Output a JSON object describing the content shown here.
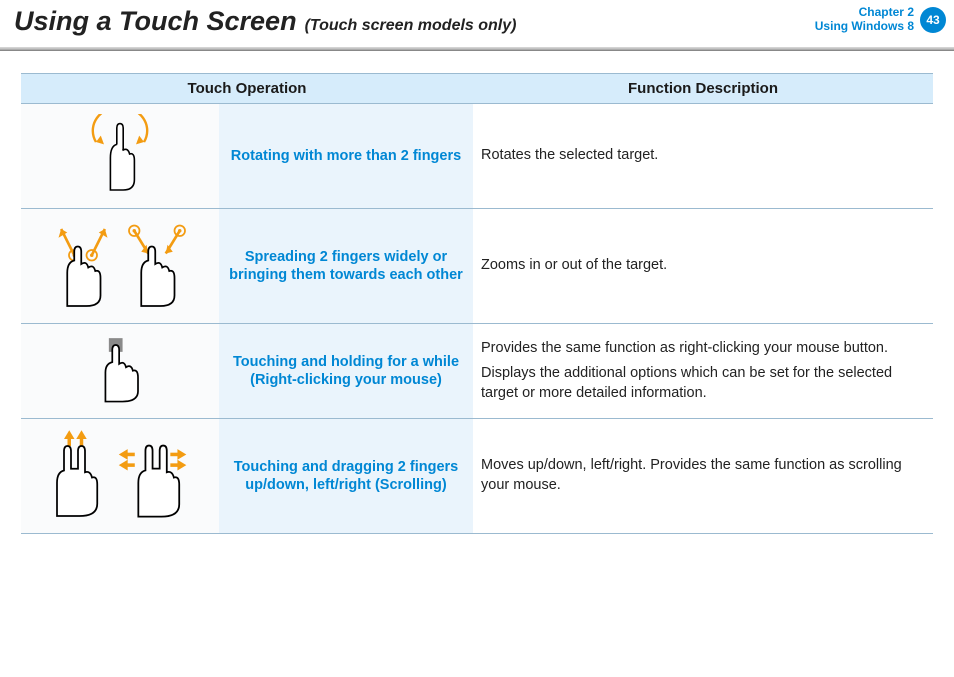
{
  "header": {
    "title_main": "Using a Touch Screen",
    "title_sub": "(Touch screen models only)",
    "chapter_line1": "Chapter 2",
    "chapter_line2": "Using Windows 8",
    "page_number": "43"
  },
  "table": {
    "head_operation": "Touch Operation",
    "head_description": "Function Description",
    "rows": [
      {
        "name": "Rotating with more than 2 fingers",
        "desc": [
          "Rotates the selected target."
        ]
      },
      {
        "name": "Spreading 2 fingers widely or bringing them towards each other",
        "desc": [
          "Zooms in or out of the target."
        ]
      },
      {
        "name": "Touching and holding for a while (Right-clicking your mouse)",
        "desc": [
          "Provides the same function as right-clicking your mouse button.",
          "Displays the additional options which can be set for the selected target or more detailed information."
        ]
      },
      {
        "name": "Touching and dragging 2 fingers up/down, left/right (Scrolling)",
        "desc": [
          "Moves up/down, left/right. Provides the same function as scrolling your mouse."
        ]
      }
    ]
  }
}
